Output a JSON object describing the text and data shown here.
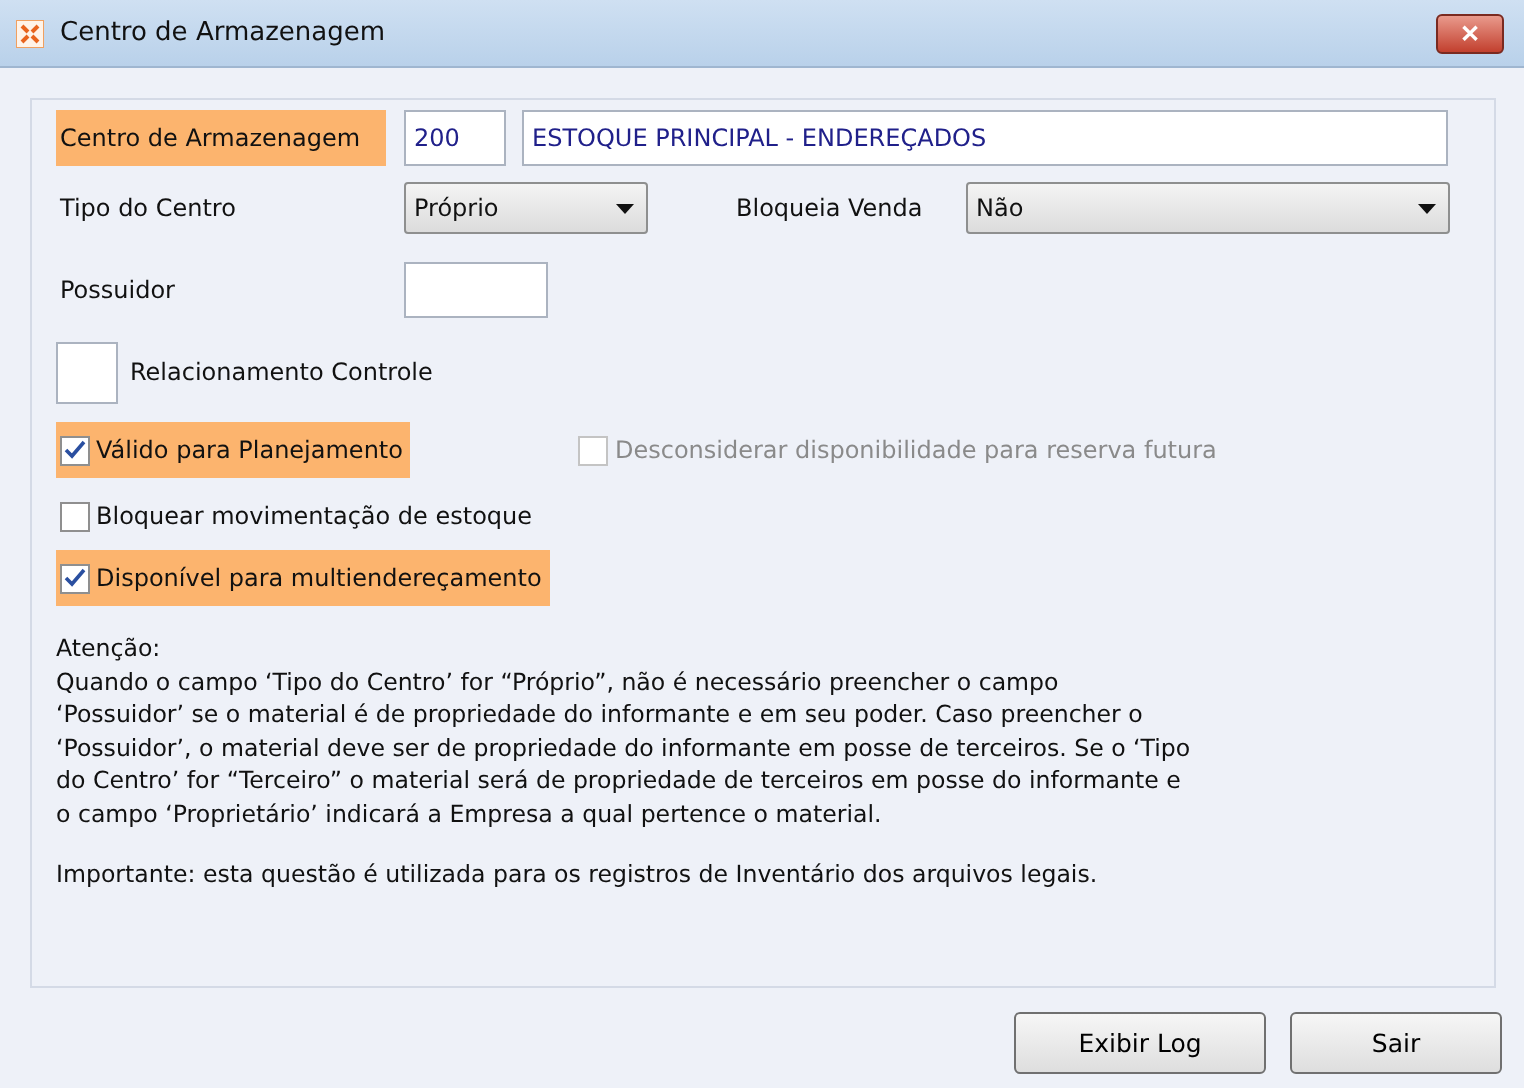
{
  "window": {
    "title": "Centro de Armazenagem",
    "close": "✕"
  },
  "centro": {
    "label": "Centro de Armazenagem",
    "highlighted": true,
    "code": "200",
    "name": "ESTOQUE PRINCIPAL - ENDEREÇADOS"
  },
  "tipo": {
    "label": "Tipo do Centro",
    "value": "Próprio"
  },
  "bloqueia": {
    "label": "Bloqueia Venda",
    "value": "Não"
  },
  "possuidor": {
    "label": "Possuidor"
  },
  "relacionamento": {
    "label": "Relacionamento Controle"
  },
  "checkboxes": [
    {
      "label": "Válido para Planejamento",
      "checked": true,
      "disabled": false,
      "highlighted": true
    },
    {
      "label": "Desconsiderar disponibilidade para reserva futura",
      "checked": false,
      "disabled": true,
      "highlighted": false
    },
    {
      "label": "Bloquear movimentação de estoque",
      "checked": false,
      "disabled": false,
      "highlighted": false
    },
    {
      "label": "Disponível para multiendereçamento",
      "checked": true,
      "disabled": false,
      "highlighted": true
    }
  ],
  "notice": {
    "heading": "Atenção:",
    "lines": [
      "Quando o campo ‘Tipo do Centro’ for “Próprio”, não é necessário preencher o campo",
      "‘Possuidor’ se o material é de propriedade do informante e em seu poder. Caso preencher o",
      "‘Possuidor’, o material deve ser de propriedade do informante em posse de terceiros. Se o ‘Tipo",
      "do Centro’ for “Terceiro” o material será de propriedade de terceiros em posse do informante e",
      "o campo ‘Proprietário’ indicará a Empresa a qual pertence o material."
    ],
    "important": "Importante: esta questão é utilizada para os registros de Inventário dos arquivos legais."
  },
  "buttons": [
    "Exibir Log",
    "Sair"
  ]
}
